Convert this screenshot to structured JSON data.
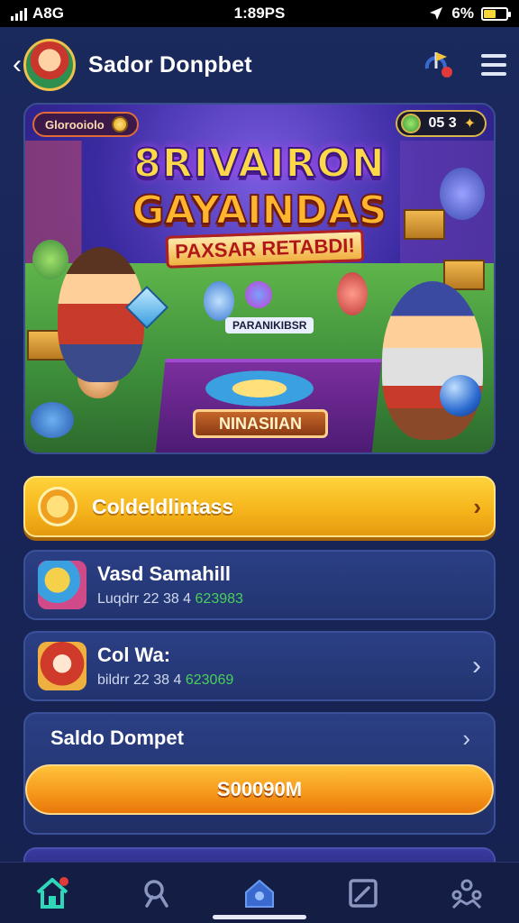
{
  "status_bar": {
    "carrier": "A8G",
    "time": "1:89PS",
    "battery": "6%"
  },
  "header": {
    "title": "Sador Donpbet"
  },
  "banner": {
    "top_pill": "Glorooiolo",
    "score": "05 3",
    "title_line1": "8RIVAIRON",
    "title_line2": "GAYAINDAS",
    "title_line3": "PAXSAR RETABDI!",
    "mini_label": "PARANIKIBSR",
    "badge_name": "NINASIIAN"
  },
  "quest_button": {
    "label": "Coldeldlintass"
  },
  "cards": [
    {
      "title": "Vasd Samahill",
      "sub_prefix": "Luqdrr 22 38 4",
      "sub_number": "623983"
    },
    {
      "title": "Col Wa:",
      "sub_prefix": "bildrr 22 38 4",
      "sub_number": "623069"
    }
  ],
  "wallet": {
    "title": "Saldo Dompet",
    "amount": "S00090M"
  },
  "nav": [
    "home-icon",
    "search-icon",
    "house-badge-icon",
    "edit-icon",
    "people-icon"
  ],
  "colors": {
    "background": "#1b2a5c",
    "quest_gradient": "#f5b31a",
    "wallet_button": "#f5961a",
    "accent_green": "#4ad05a"
  }
}
